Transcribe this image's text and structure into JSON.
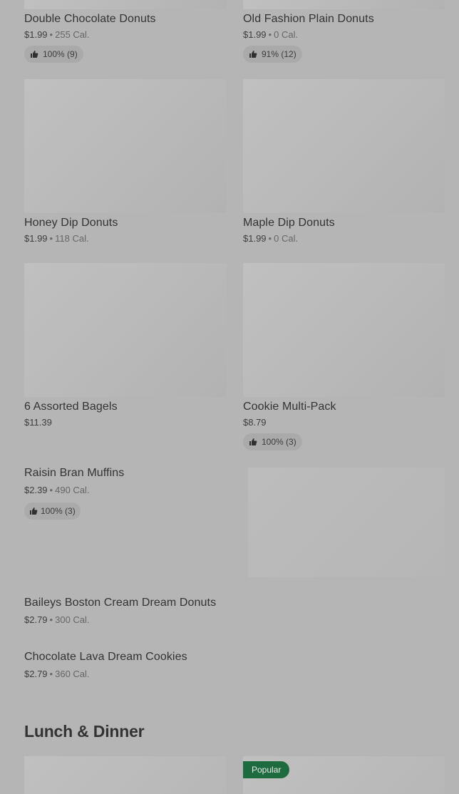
{
  "grid_items": [
    {
      "id": "double-chocolate",
      "title": "Double Chocolate Donuts",
      "price": "$1.99",
      "cal": "255 Cal.",
      "rating": "100% (9)"
    },
    {
      "id": "old-fashion-plain",
      "title": "Old Fashion Plain Donuts",
      "price": "$1.99",
      "cal": "0 Cal.",
      "rating": "91% (12)"
    },
    {
      "id": "honey-dip",
      "title": "Honey Dip Donuts",
      "price": "$1.99",
      "cal": "118 Cal."
    },
    {
      "id": "maple-dip",
      "title": "Maple Dip Donuts",
      "price": "$1.99",
      "cal": "0 Cal."
    },
    {
      "id": "assorted-bagels",
      "title": "6 Assorted Bagels",
      "price": "$11.39"
    },
    {
      "id": "cookie-multipack",
      "title": "Cookie Multi-Pack",
      "price": "$8.79",
      "rating": "100% (3)"
    }
  ],
  "list_items": [
    {
      "id": "raisin-bran",
      "title": "Raisin Bran Muffins",
      "price": "$2.39",
      "cal": "490 Cal.",
      "rating": "100% (3)"
    },
    {
      "id": "baileys",
      "title": "Baileys Boston Cream Dream Donuts",
      "price": "$2.79",
      "cal": "300 Cal."
    },
    {
      "id": "lava-cookies",
      "title": "Chocolate Lava Dream Cookies",
      "price": "$2.79",
      "cal": "360 Cal."
    }
  ],
  "separator": "•",
  "section": {
    "title": "Lunch & Dinner"
  },
  "badge": {
    "label": "Popular"
  },
  "icons": {
    "rating": "thumbs-up-icon"
  },
  "colors": {
    "overlay": "#b5b5b5",
    "badge": "#1f6b40"
  }
}
